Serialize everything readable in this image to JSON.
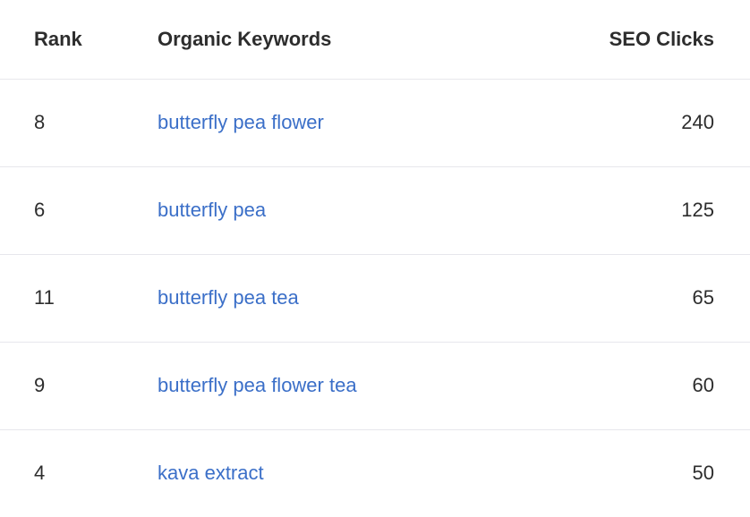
{
  "table": {
    "columns": [
      {
        "key": "rank",
        "label": "Rank",
        "align": "left"
      },
      {
        "key": "keyword",
        "label": "Organic Keywords",
        "align": "left"
      },
      {
        "key": "clicks",
        "label": "SEO Clicks",
        "align": "right"
      }
    ],
    "rows": [
      {
        "rank": "8",
        "keyword": "butterfly pea flower",
        "clicks": "240"
      },
      {
        "rank": "6",
        "keyword": "butterfly pea",
        "clicks": "125"
      },
      {
        "rank": "11",
        "keyword": "butterfly pea tea",
        "clicks": "65"
      },
      {
        "rank": "9",
        "keyword": "butterfly pea flower tea",
        "clicks": "60"
      },
      {
        "rank": "4",
        "keyword": "kava extract",
        "clicks": "50"
      }
    ]
  },
  "colors": {
    "link": "#3b6fc8",
    "text": "#2d2d2d",
    "divider": "#e7e7ec",
    "background": "#ffffff"
  }
}
